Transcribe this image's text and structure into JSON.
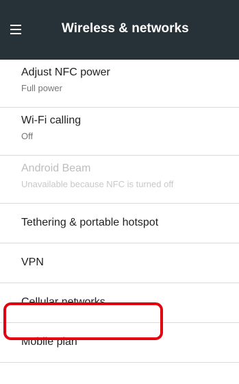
{
  "toolbar": {
    "title": "Wireless & networks",
    "menu_icon": "hamburger-menu-icon",
    "background": "#263238"
  },
  "settings": [
    {
      "title": "Adjust NFC power",
      "summary": "Full power",
      "enabled": true
    },
    {
      "title": "Wi-Fi calling",
      "summary": "Off",
      "enabled": true
    },
    {
      "title": "Android Beam",
      "summary": "Unavailable because NFC is turned off",
      "enabled": false
    },
    {
      "title": "Tethering & portable hotspot",
      "enabled": true
    },
    {
      "title": "VPN",
      "enabled": true
    },
    {
      "title": "Cellular networks",
      "enabled": true,
      "highlighted": true
    },
    {
      "title": "Mobile plan",
      "enabled": true
    }
  ],
  "highlight_color": "#e3000f"
}
